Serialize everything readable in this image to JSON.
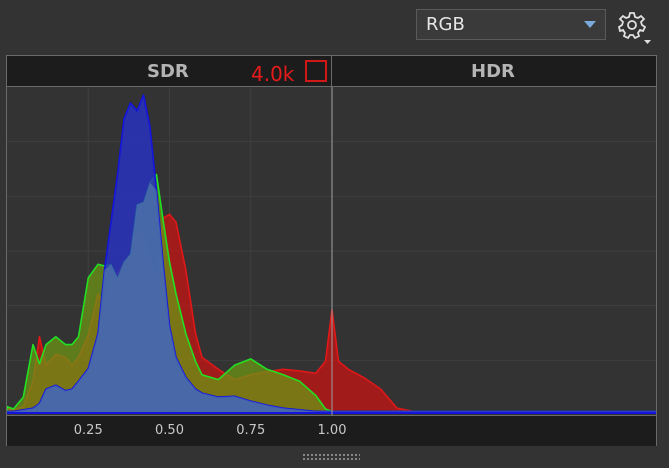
{
  "toolbar": {
    "channel_select": "RGB",
    "settings_icon": "gear-icon"
  },
  "histogram": {
    "sdr_label": "SDR",
    "hdr_label": "HDR",
    "peak_count": "4.0k",
    "colors": {
      "red": "#e01818",
      "green": "#22e022",
      "blue": "#1414dd",
      "background": "#333333",
      "bar": "#1c1c1c"
    }
  },
  "chart_data": {
    "type": "area",
    "xlabel": "",
    "ylabel": "",
    "xlim": [
      0,
      2.0
    ],
    "ylim": [
      0,
      4000
    ],
    "grid": true,
    "tick_labels": [
      "0.25",
      "0.50",
      "0.75",
      "1.00"
    ],
    "x": [
      0.0,
      0.02,
      0.05,
      0.08,
      0.1,
      0.12,
      0.15,
      0.18,
      0.2,
      0.22,
      0.25,
      0.28,
      0.3,
      0.32,
      0.34,
      0.36,
      0.38,
      0.4,
      0.42,
      0.44,
      0.46,
      0.48,
      0.5,
      0.52,
      0.55,
      0.58,
      0.6,
      0.65,
      0.7,
      0.75,
      0.8,
      0.85,
      0.9,
      0.95,
      0.98,
      1.0,
      1.02,
      1.05,
      1.1,
      1.15,
      1.2,
      1.25,
      2.0
    ],
    "series": [
      {
        "name": "Red",
        "values": [
          60,
          40,
          80,
          400,
          960,
          600,
          740,
          700,
          600,
          700,
          980,
          1500,
          1300,
          1700,
          1750,
          1900,
          2000,
          2300,
          2200,
          1900,
          1650,
          2450,
          2500,
          2400,
          1800,
          1000,
          700,
          550,
          420,
          480,
          520,
          550,
          530,
          500,
          650,
          1300,
          650,
          550,
          440,
          300,
          60,
          20,
          20
        ]
      },
      {
        "name": "Green",
        "values": [
          80,
          50,
          200,
          860,
          620,
          860,
          960,
          860,
          860,
          960,
          1700,
          1870,
          1850,
          1870,
          1700,
          1900,
          2000,
          2620,
          2650,
          2900,
          3000,
          2430,
          1900,
          1500,
          1000,
          650,
          480,
          420,
          600,
          680,
          550,
          480,
          400,
          220,
          50,
          20,
          20,
          20,
          20,
          20,
          20,
          20,
          20
        ]
      },
      {
        "name": "Blue",
        "values": [
          20,
          20,
          40,
          60,
          120,
          300,
          350,
          280,
          300,
          400,
          560,
          1000,
          1800,
          2400,
          3000,
          3700,
          3900,
          3800,
          4000,
          3600,
          2800,
          1900,
          1100,
          700,
          450,
          300,
          250,
          200,
          210,
          150,
          100,
          60,
          40,
          20,
          20,
          20,
          20,
          20,
          20,
          20,
          20,
          20,
          20
        ]
      }
    ]
  }
}
